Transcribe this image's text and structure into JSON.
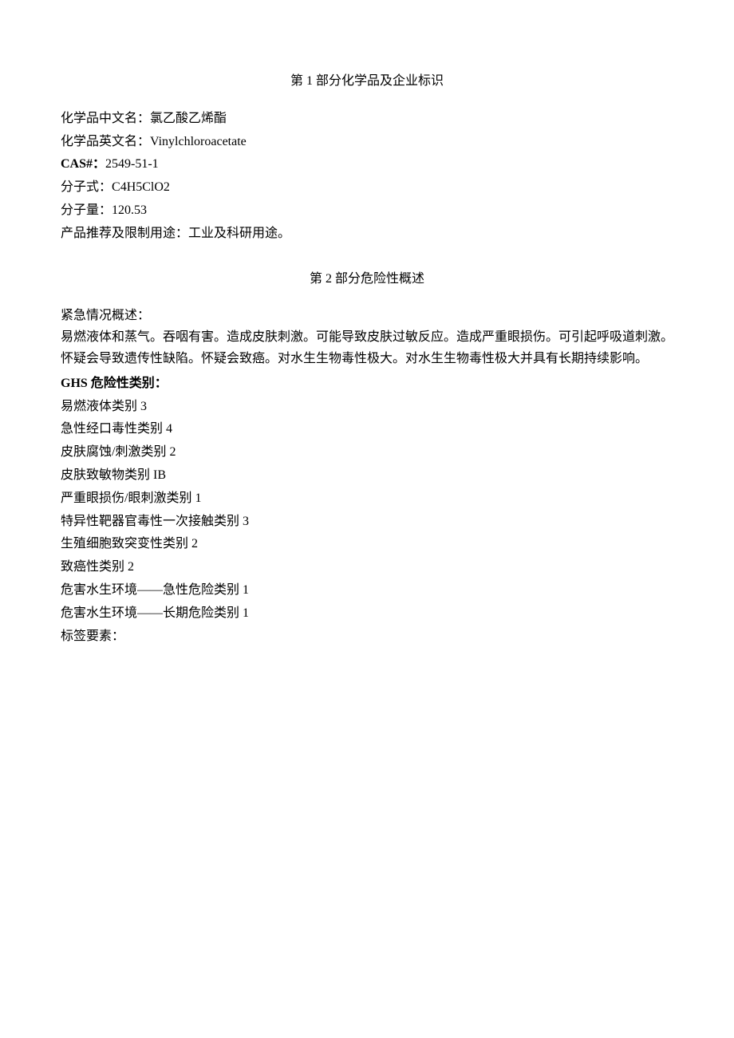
{
  "section1": {
    "title": "第 1 部分化学品及企业标识",
    "name_cn_label": "化学品中文名：",
    "name_cn_value": "氯乙酸乙烯酯",
    "name_en_label": "化学品英文名：",
    "name_en_value": "Vinylchloroacetate",
    "cas_label": "CAS#：",
    "cas_value": "2549-51-1",
    "formula_label": "分子式：",
    "formula_value": "C4H5ClO2",
    "mw_label": "分子量：",
    "mw_value": "120.53",
    "use_label": "产品推荐及限制用途：",
    "use_value": "工业及科研用途。"
  },
  "section2": {
    "title": "第 2 部分危险性概述",
    "emergency_label": "紧急情况概述：",
    "emergency_line1": "易燃液体和蒸气。吞咽有害。造成皮肤刺激。可能导致皮肤过敏反应。造成严重眼损伤。可引起呼吸道刺激。",
    "emergency_line2": "怀疑会导致遗传性缺陷。怀疑会致癌。对水生生物毒性极大。对水生生物毒性极大并具有长期持续影响。",
    "ghs_label": "GHS 危险性类别：",
    "categories": [
      "易燃液体类别 3",
      "急性经口毒性类别 4",
      "皮肤腐蚀/刺激类别 2",
      "皮肤致敏物类别 IB",
      "严重眼损伤/眼刺激类别 1",
      "特异性靶器官毒性一次接触类别 3",
      "生殖细胞致突变性类别 2",
      "致癌性类别 2",
      "危害水生环境——急性危险类别 1",
      "危害水生环境——长期危险类别 1"
    ],
    "label_elements": "标签要素："
  }
}
